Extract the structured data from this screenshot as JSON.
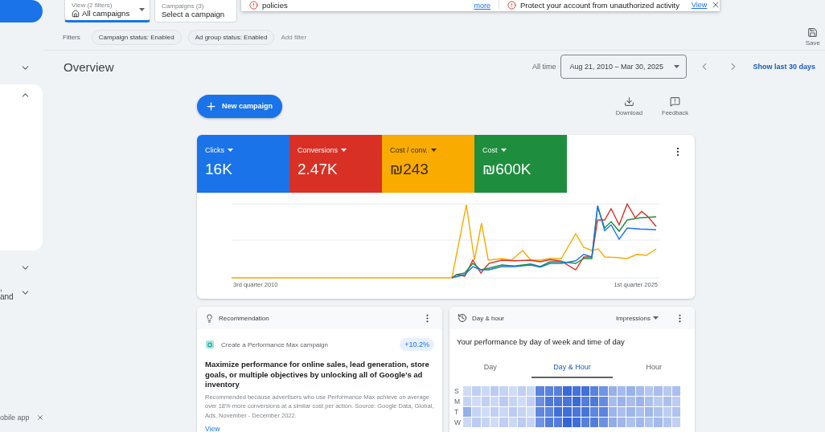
{
  "sidebar": {
    "sections": [
      {
        "expanded": false
      },
      {
        "expanded": true
      },
      {
        "expanded": false
      },
      {
        "text": ", and",
        "expanded": false
      }
    ],
    "footer": {
      "text": "obile app"
    }
  },
  "view_selector": {
    "label": "View (2 filters)",
    "value": "All campaigns"
  },
  "campaign_selector": {
    "label": "Campaigns (3)",
    "value": "Select a campaign"
  },
  "notifications": [
    {
      "text": "policies",
      "link": "more"
    },
    {
      "text": "Protect your account from unauthorized activity",
      "link": "View"
    }
  ],
  "save": {
    "label": "Save"
  },
  "filters": {
    "label": "Filters",
    "chips": [
      "Campaign status: Enabled",
      "Ad group status: Enabled"
    ],
    "add": "Add filter"
  },
  "overview": {
    "title": "Overview",
    "range_label": "All time",
    "date_range": "Aug 21, 2010 – Mar 30, 2025",
    "show_last": "Show last 30 days"
  },
  "actions": {
    "new_campaign": "New campaign",
    "tools": [
      {
        "kind": "download",
        "label": "Download"
      },
      {
        "kind": "feedback",
        "label": "Feedback"
      }
    ]
  },
  "metrics": [
    {
      "name": "Clicks",
      "value": "16K",
      "color": "#1a73e8",
      "selected": true
    },
    {
      "name": "Conversions",
      "value": "2.47K",
      "color": "#d93025",
      "selected": true
    },
    {
      "name": "Cost / conv.",
      "value": "₪243",
      "color": "#f9ab00",
      "selected": true
    },
    {
      "name": "Cost",
      "value": "₪600K",
      "color": "#1e8e3e",
      "selected": true
    }
  ],
  "chart": {
    "x_labels": [
      "3rd quarter 2010",
      "1st quarter 2025"
    ]
  },
  "recommendation": {
    "title": "Recommendation",
    "item": "Create a Performance Max campaign",
    "uplift": "+10.2%",
    "headline": "Maximize performance for online sales, lead generation, store goals, or multiple objectives by unlocking all of Google's ad inventory",
    "detail": "Recommended because advertisers who use Performance Max achieve on average over 18% more conversions at a similar cost per action. Source: Google Data, Global, Ads, November - December 2022.",
    "link": "View"
  },
  "day_hour": {
    "title": "Day & hour",
    "metric": "Impressions",
    "heading": "Your performance by day of week and time of day",
    "tabs": [
      {
        "label": "Day",
        "selected": false
      },
      {
        "label": "Day & Hour",
        "selected": true
      },
      {
        "label": "Hour",
        "selected": false
      }
    ],
    "days": [
      "S",
      "M",
      "T",
      "W"
    ]
  }
}
